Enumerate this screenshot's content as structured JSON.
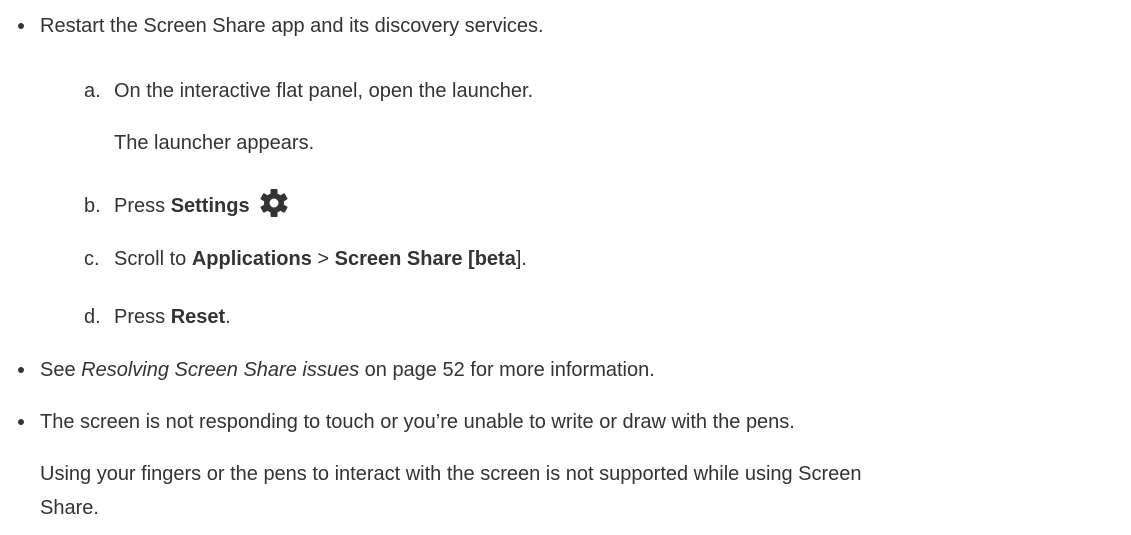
{
  "bullet1": {
    "text": "Restart the Screen Share app and its discovery services."
  },
  "steps": {
    "a": {
      "marker": "a.",
      "text": "On the interactive flat panel, open the launcher.",
      "result": "The launcher appears."
    },
    "b": {
      "marker": "b.",
      "pre": "Press ",
      "bold": "Settings",
      "icon": "gear-icon"
    },
    "c": {
      "marker": "c.",
      "pre": "Scroll to ",
      "bold1": "Applications",
      "sep": " > ",
      "bold2": "Screen Share [beta",
      "post_bracket": "]",
      "end": "."
    },
    "d": {
      "marker": "d.",
      "pre": "Press ",
      "bold": "Reset",
      "end": "."
    }
  },
  "bullet2": {
    "pre": "See ",
    "italic": "Resolving Screen Share issues",
    "post": " on page 52 for more information."
  },
  "bullet3": {
    "text": "The screen is not responding to touch or you’re unable to write or draw with the pens."
  },
  "note": {
    "line1": "Using your fingers or the pens to interact with the screen is not supported while using Screen",
    "line2": "Share."
  }
}
